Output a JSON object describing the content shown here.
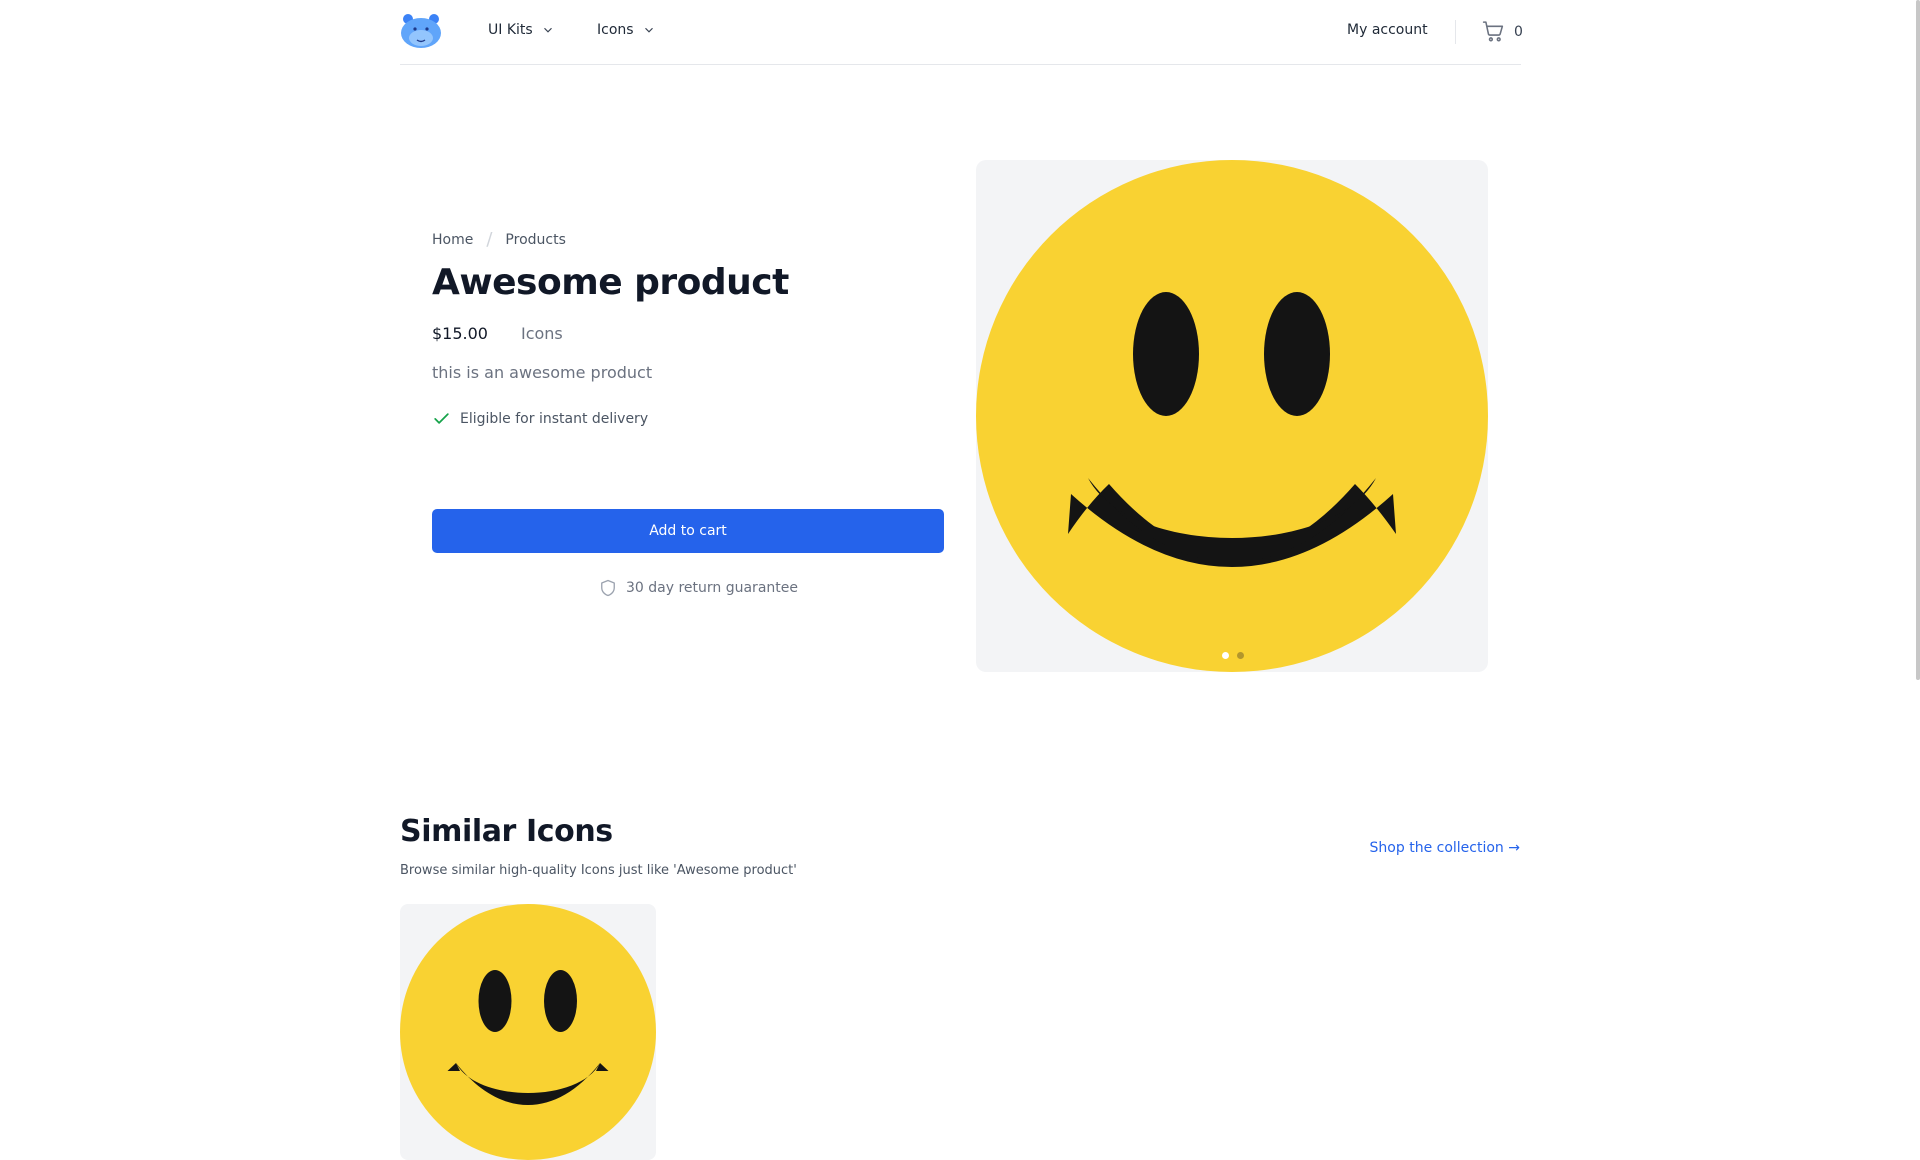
{
  "header": {
    "logo_icon": "hippo-logo-icon",
    "nav": [
      {
        "label": "UI Kits",
        "icon": "chevron-down-icon"
      },
      {
        "label": "Icons",
        "icon": "chevron-down-icon"
      }
    ],
    "my_account": "My account",
    "cart_icon": "shopping-cart-icon",
    "cart_count": "0"
  },
  "breadcrumb": [
    "Home",
    "/",
    "Products"
  ],
  "product": {
    "title": "Awesome product",
    "price": "$15.00",
    "category": "Icons",
    "description": "this is an awesome product",
    "delivery": "Eligible for instant delivery",
    "delivery_icon": "check-icon",
    "add_to_cart": "Add to cart",
    "guarantee": "30 day return guarantee",
    "guarantee_icon": "shield-icon",
    "image": "smiley-face-image",
    "carousel_dots": 2,
    "carousel_active": 1
  },
  "similar": {
    "title": "Similar Icons",
    "subtitle": "Browse similar high-quality Icons just like 'Awesome product'",
    "shop_link": "Shop the collection →",
    "items": [
      {
        "image": "smiley-face-image"
      }
    ]
  },
  "colors": {
    "primary": "#2563eb",
    "smiley_yellow": "#f9d232",
    "smiley_features": "#141414",
    "check_green": "#16a34a",
    "image_bg": "#f3f4f6"
  }
}
